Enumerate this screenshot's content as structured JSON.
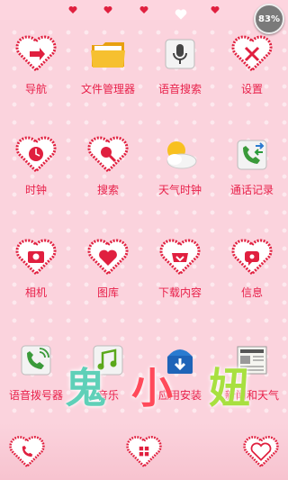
{
  "status": {
    "battery": "83%"
  },
  "apps": [
    {
      "label": "导航",
      "icon": "navigation-heart-icon"
    },
    {
      "label": "文件管理器",
      "icon": "folder-icon"
    },
    {
      "label": "语音搜索",
      "icon": "microphone-icon"
    },
    {
      "label": "设置",
      "icon": "settings-heart-icon"
    },
    {
      "label": "时钟",
      "icon": "clock-heart-icon"
    },
    {
      "label": "搜索",
      "icon": "search-heart-icon"
    },
    {
      "label": "天气时钟",
      "icon": "weather-icon"
    },
    {
      "label": "通话记录",
      "icon": "call-log-icon"
    },
    {
      "label": "相机",
      "icon": "camera-heart-icon"
    },
    {
      "label": "图库",
      "icon": "gallery-heart-icon"
    },
    {
      "label": "下载内容",
      "icon": "download-heart-icon"
    },
    {
      "label": "信息",
      "icon": "message-heart-icon"
    },
    {
      "label": "语音拨号器",
      "icon": "voice-dialer-icon"
    },
    {
      "label": "音乐",
      "icon": "music-icon"
    },
    {
      "label": "应用安装",
      "icon": "app-installer-icon"
    },
    {
      "label": "新闻和天气",
      "icon": "news-icon"
    }
  ],
  "watermark": [
    "鬼",
    "小",
    "妞"
  ],
  "colors": {
    "label": "#e8204a",
    "heart": "#e0203f",
    "background": "#fbd3dd"
  }
}
